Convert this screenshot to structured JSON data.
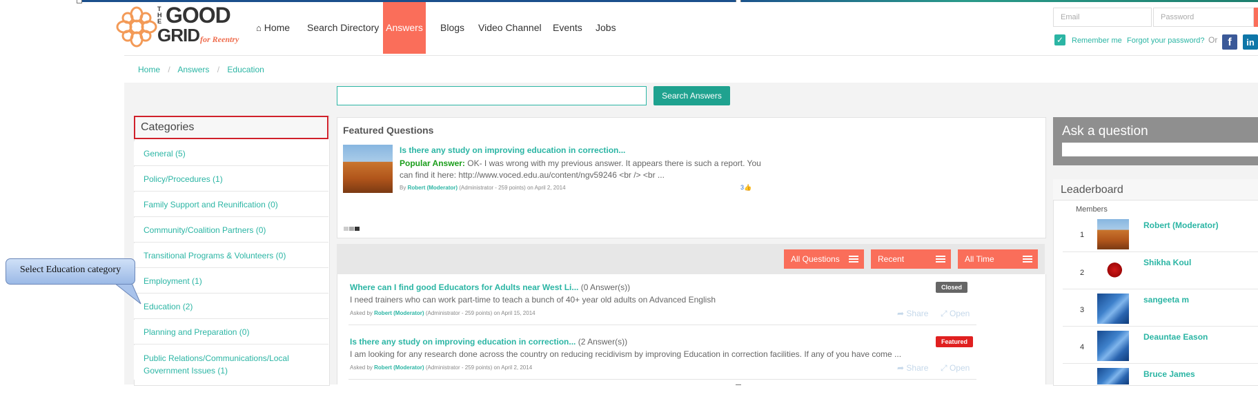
{
  "brand": {
    "logo_the": "THE",
    "logo_good": "GOOD",
    "logo_grid": "GRID",
    "logo_tagline": "for Reentry"
  },
  "nav": {
    "items": [
      "Home",
      "Search Directory",
      "Answers",
      "Blogs",
      "Video Channel",
      "Events",
      "Jobs"
    ],
    "active": "Answers"
  },
  "login": {
    "email_placeholder": "Email",
    "password_placeholder": "Password",
    "remember_me": "Remember me",
    "forgot": "Forgot your password?",
    "or": "Or"
  },
  "breadcrumb": [
    "Home",
    "Answers",
    "Education"
  ],
  "search": {
    "input_value": "",
    "button_label": "Search Answers"
  },
  "categories": {
    "title": "Categories",
    "items": [
      "General (5)",
      "Policy/Procedures (1)",
      "Family Support and Reunification (0)",
      "Community/Coalition Partners (0)",
      "Transitional Programs & Volunteers (0)",
      "Employment (1)",
      "Education (2)",
      "Planning and Preparation (0)",
      "Public Relations/Communications/Local",
      "Government Issues (1)"
    ]
  },
  "callout": {
    "text": "Select Education category"
  },
  "featured": {
    "title": "Featured Questions",
    "question": "Is there any study on improving education in correction...",
    "popular_label": "Popular Answer:",
    "answer_line1": "OK- I was wrong with my previous answer. It appears there is such a report. You",
    "answer_line2": "can find it here: http://www.voced.edu.au/content/ngv59246 <br /> <br ...",
    "by": "By",
    "author": "Robert (Moderator)",
    "author_meta": "(Administrator - 259 points)",
    "date": "on April 2, 2014",
    "likes": "3"
  },
  "filters": [
    "All Questions",
    "Recent",
    "All Time"
  ],
  "questions": [
    {
      "title": "Where can I find good Educators for Adults near West Li...",
      "count": "(0 Answer(s))",
      "body": "I need trainers who can work part-time to teach a bunch of 40+ year old adults on Advanced English",
      "asked_by": "Asked by",
      "author": "Robert (Moderator)",
      "meta": "(Administrator - 259 points)",
      "date": "on April 15, 2014",
      "badge": "Closed",
      "badge_color": "#666666",
      "share": "Share",
      "open": "Open"
    },
    {
      "title": "Is there any study on improving education in correction...",
      "count": "(2 Answer(s))",
      "body": "I am looking for any research done across the country on reducing recidivism by improving Education in correction facilities. If any of you have come ...",
      "asked_by": "Asked by",
      "author": "Robert (Moderator)",
      "meta": "(Administrator - 259 points)",
      "date": "on April 2, 2014",
      "badge": "Featured",
      "badge_color": "#e02020",
      "share": "Share",
      "open": "Open"
    }
  ],
  "ask": {
    "title": "Ask a question"
  },
  "leaderboard": {
    "title": "Leaderboard",
    "members_label": "Members",
    "rows": [
      {
        "rank": "1",
        "name": "Robert (Moderator)",
        "avatar": "rock"
      },
      {
        "rank": "2",
        "name": "Shikha Koul",
        "avatar": "rose"
      },
      {
        "rank": "3",
        "name": "sangeeta m",
        "avatar": "blue"
      },
      {
        "rank": "4",
        "name": "Deauntae Eason",
        "avatar": "blue"
      },
      {
        "rank": "",
        "name": "Bruce James",
        "avatar": "blue"
      }
    ]
  },
  "colors": {
    "accent": "#2bb5a4",
    "nav_active": "#fa6e5a",
    "featured_badge": "#e02020",
    "closed_badge": "#666666"
  }
}
